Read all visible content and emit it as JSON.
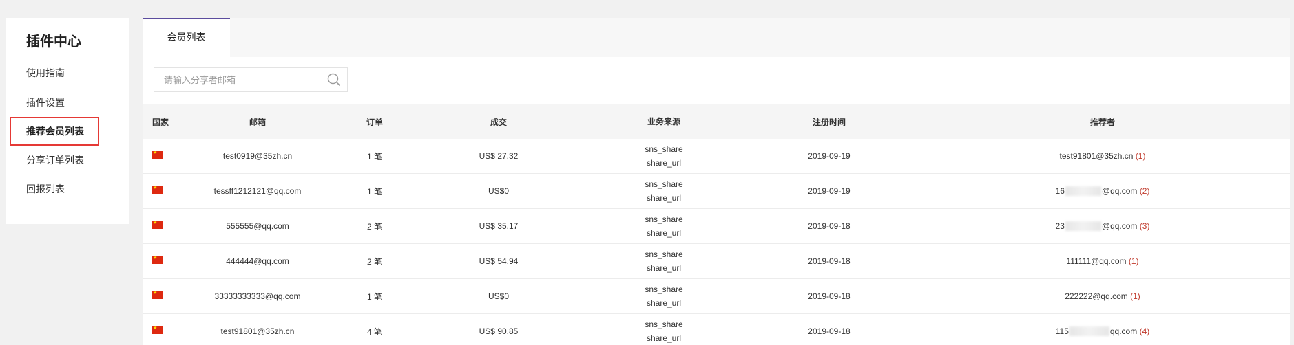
{
  "sidebar": {
    "title": "插件中心",
    "items": [
      {
        "label": "使用指南",
        "active": false
      },
      {
        "label": "插件设置",
        "active": false
      },
      {
        "label": "推荐会员列表",
        "active": true
      },
      {
        "label": "分享订单列表",
        "active": false
      },
      {
        "label": "回报列表",
        "active": false
      }
    ]
  },
  "tabs": [
    {
      "label": "会员列表",
      "active": true
    }
  ],
  "search": {
    "placeholder": "请输入分享者邮箱",
    "value": "",
    "icon": "search-icon"
  },
  "table": {
    "headers": {
      "country": "国家",
      "email": "邮箱",
      "orders": "订单",
      "deals": "成交",
      "source": "业务来源",
      "registered": "注册时间",
      "referrer": "推荐者"
    },
    "rows": [
      {
        "country_icon": "china-flag-icon",
        "email": "test0919@35zh.cn",
        "orders": "1 笔",
        "deals": "US$ 27.32",
        "source1": "sns_share",
        "source2": "share_url",
        "registered": "2019-09-19",
        "ref_prefix": "test91801@35zh.cn",
        "ref_suffix": "",
        "ref_count": "(1)",
        "ref_masked": false
      },
      {
        "country_icon": "china-flag-icon",
        "email": "tessff1212121@qq.com",
        "orders": "1 笔",
        "deals": "US$0",
        "source1": "sns_share",
        "source2": "share_url",
        "registered": "2019-09-19",
        "ref_prefix": "16",
        "ref_suffix": "@qq.com",
        "ref_count": "(2)",
        "ref_masked": true
      },
      {
        "country_icon": "china-flag-icon",
        "email": "555555@qq.com",
        "orders": "2 笔",
        "deals": "US$ 35.17",
        "source1": "sns_share",
        "source2": "share_url",
        "registered": "2019-09-18",
        "ref_prefix": "23",
        "ref_suffix": "@qq.com",
        "ref_count": "(3)",
        "ref_masked": true
      },
      {
        "country_icon": "china-flag-icon",
        "email": "444444@qq.com",
        "orders": "2 笔",
        "deals": "US$ 54.94",
        "source1": "sns_share",
        "source2": "share_url",
        "registered": "2019-09-18",
        "ref_prefix": "111111@qq.com",
        "ref_suffix": "",
        "ref_count": "(1)",
        "ref_masked": false
      },
      {
        "country_icon": "china-flag-icon",
        "email": "33333333333@qq.com",
        "orders": "1 笔",
        "deals": "US$0",
        "source1": "sns_share",
        "source2": "share_url",
        "registered": "2019-09-18",
        "ref_prefix": "222222@qq.com",
        "ref_suffix": "",
        "ref_count": "(1)",
        "ref_masked": false
      },
      {
        "country_icon": "china-flag-icon",
        "email": "test91801@35zh.cn",
        "orders": "4 笔",
        "deals": "US$ 90.85",
        "source1": "sns_share",
        "source2": "share_url",
        "registered": "2019-09-18",
        "ref_prefix": "115",
        "ref_suffix": "qq.com",
        "ref_count": "(4)",
        "ref_masked": true
      }
    ]
  },
  "colors": {
    "accent": "#5c4d9e",
    "highlight_border": "#e53935",
    "count_red": "#c0392b"
  }
}
